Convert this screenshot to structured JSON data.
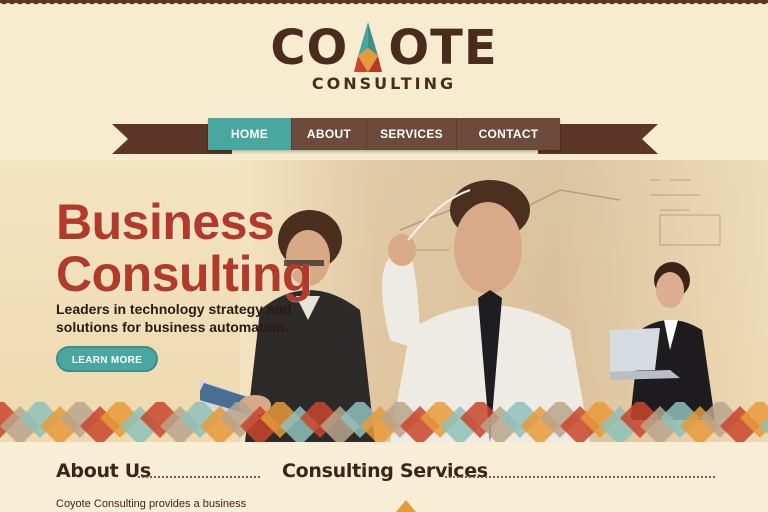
{
  "brand": {
    "name_left": "CO",
    "name_right": "OTE",
    "tagline": "CONSULTING",
    "colors": {
      "dark_brown": "#4a2c1f",
      "red": "#c9452b",
      "teal": "#4aa6a1",
      "orange": "#e79a3a"
    }
  },
  "nav": {
    "items": [
      {
        "label": "HOME",
        "active": true
      },
      {
        "label": "ABOUT",
        "active": false
      },
      {
        "label": "SERVICES",
        "active": false
      },
      {
        "label": "CONTACT",
        "active": false
      }
    ]
  },
  "hero": {
    "title_line1": "Business",
    "title_line2": "Consulting",
    "subtitle": "Leaders in technology strategy and solutions for business automation.",
    "cta_label": "LEARN MORE"
  },
  "about": {
    "heading": "About Us",
    "text": "Coyote Consulting provides a business"
  },
  "services": {
    "heading": "Consulting Services"
  }
}
